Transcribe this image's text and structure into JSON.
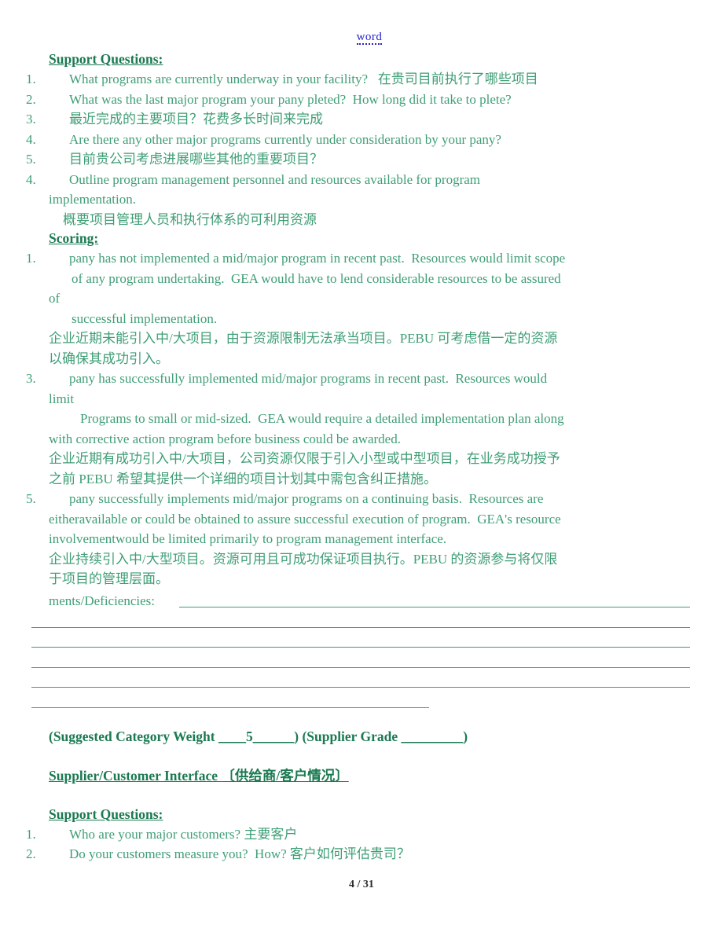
{
  "header": {
    "watermark_link": "word"
  },
  "section1": {
    "support_heading": "Support Questions:",
    "questions": [
      {
        "num": "1.",
        "text": "What programs are currently underway in your facility?   在贵司目前执行了哪些项目"
      },
      {
        "num": "2.",
        "text": "What was the last major program your pany pleted?  How long did it take to plete?"
      },
      {
        "num": "3.",
        "text": "最近完成的主要项目？花费多长时间来完成"
      },
      {
        "num": "4.",
        "text": "Are there any other major programs currently under consideration by your pany?"
      },
      {
        "num": "5.",
        "text": "目前贵公司考虑进展哪些其他的重要项目？"
      },
      {
        "num": "4.",
        "text": "Outline program management personnel and resources available for program"
      }
    ],
    "q6_continuation": "implementation.",
    "q6_chinese": "概要项目管理人员和执行体系的可利用资源"
  },
  "scoring": {
    "heading": "Scoring:",
    "item1": {
      "num": "1.",
      "line1": "pany has not implemented a mid/major program in recent past.  Resources would limit scope",
      "line2": "of any program undertaking.  GEA would have to lend considerable resources to be assured",
      "line3": "of",
      "line4": "successful implementation.",
      "cn1": "企业近期未能引入中/大项目，由于资源限制无法承当项目。PEBU 可考虑借一定的资源",
      "cn2": "以确保其成功引入。"
    },
    "item3": {
      "num": "3.",
      "line1": "pany has successfully implemented mid/major programs in recent past.  Resources would",
      "line2": "limit",
      "line3": "Programs to small or mid-sized.  GEA would require a detailed implementation plan along",
      "line4": "with corrective action program before business could be awarded.",
      "cn1": "企业近期有成功引入中/大项目，公司资源仅限于引入小型或中型项目，在业务成功授予",
      "cn2": "之前 PEBU 希望其提供一个详细的项目计划其中需包含纠正措施。"
    },
    "item5": {
      "num": "5.",
      "line1": "pany successfully implements mid/major programs on a continuing basis.  Resources are",
      "line2": "eitheravailable or could be obtained to assure successful execution of program.  GEA's resource",
      "line3": "involvementwould be limited primarily to program management interface.",
      "cn1": "企业持续引入中/大型项目。资源可用且可成功保证项目执行。PEBU 的资源参与将仅限",
      "cn2": "于项目的管理层面。"
    }
  },
  "comments": {
    "label": "ments/Deficiencies:"
  },
  "weights": {
    "prefix_open": "(Suggested Category Weight ",
    "blank_before": "____",
    "value": "5",
    "blank_after": "______",
    "prefix_close": ")",
    "grade_open": "  (Supplier Grade ",
    "grade_blank": "_________",
    "grade_close": ")"
  },
  "section2": {
    "heading_en": "Supplier/Customer Interface ",
    "heading_cn": " 〔供给商/客户情况〕",
    "support_heading": "Support Questions:",
    "questions": [
      {
        "num": "1.",
        "text": "Who are your major customers? 主要客户"
      },
      {
        "num": "2.",
        "text": "Do your customers measure you?  How? 客户如何评估贵司？"
      }
    ]
  },
  "footer": {
    "page_label": "4 / 31"
  },
  "colors": {
    "heading_green": "#1b7a52",
    "body_green": "#3f9e76",
    "link_blue": "#2222cc",
    "footer_gray": "#2b2b2b"
  }
}
